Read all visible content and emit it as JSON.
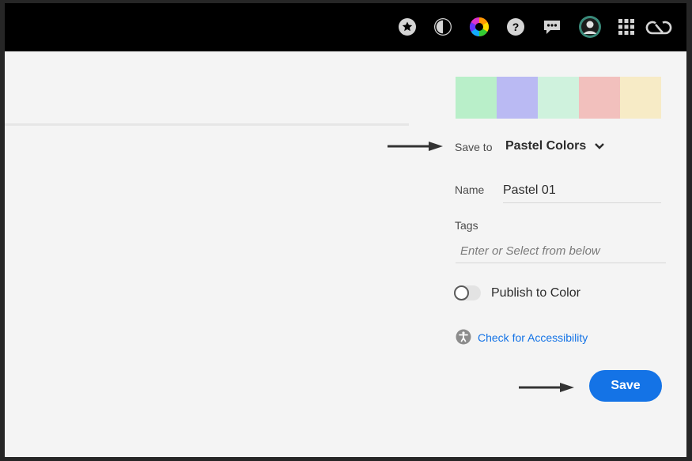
{
  "topbar": {
    "icons": [
      "star-icon",
      "contrast-icon",
      "color-wheel-icon",
      "help-icon",
      "chat-icon",
      "avatar",
      "apps-grid-icon",
      "creative-cloud-icon"
    ]
  },
  "palette": {
    "swatches": [
      "#b9efc9",
      "#babaf3",
      "#cff2dd",
      "#f2c0bd",
      "#f7ebc6"
    ]
  },
  "form": {
    "save_to_label": "Save to",
    "save_to_value": "Pastel Colors",
    "name_label": "Name",
    "name_value": "Pastel 01",
    "tags_label": "Tags",
    "tags_placeholder": "Enter or Select from below",
    "publish_label": "Publish to Color",
    "publish_enabled": false,
    "accessibility_link": "Check for Accessibility",
    "save_button": "Save"
  },
  "colors": {
    "accent": "#1473e6",
    "topbar": "#000000",
    "background": "#f4f4f4"
  }
}
